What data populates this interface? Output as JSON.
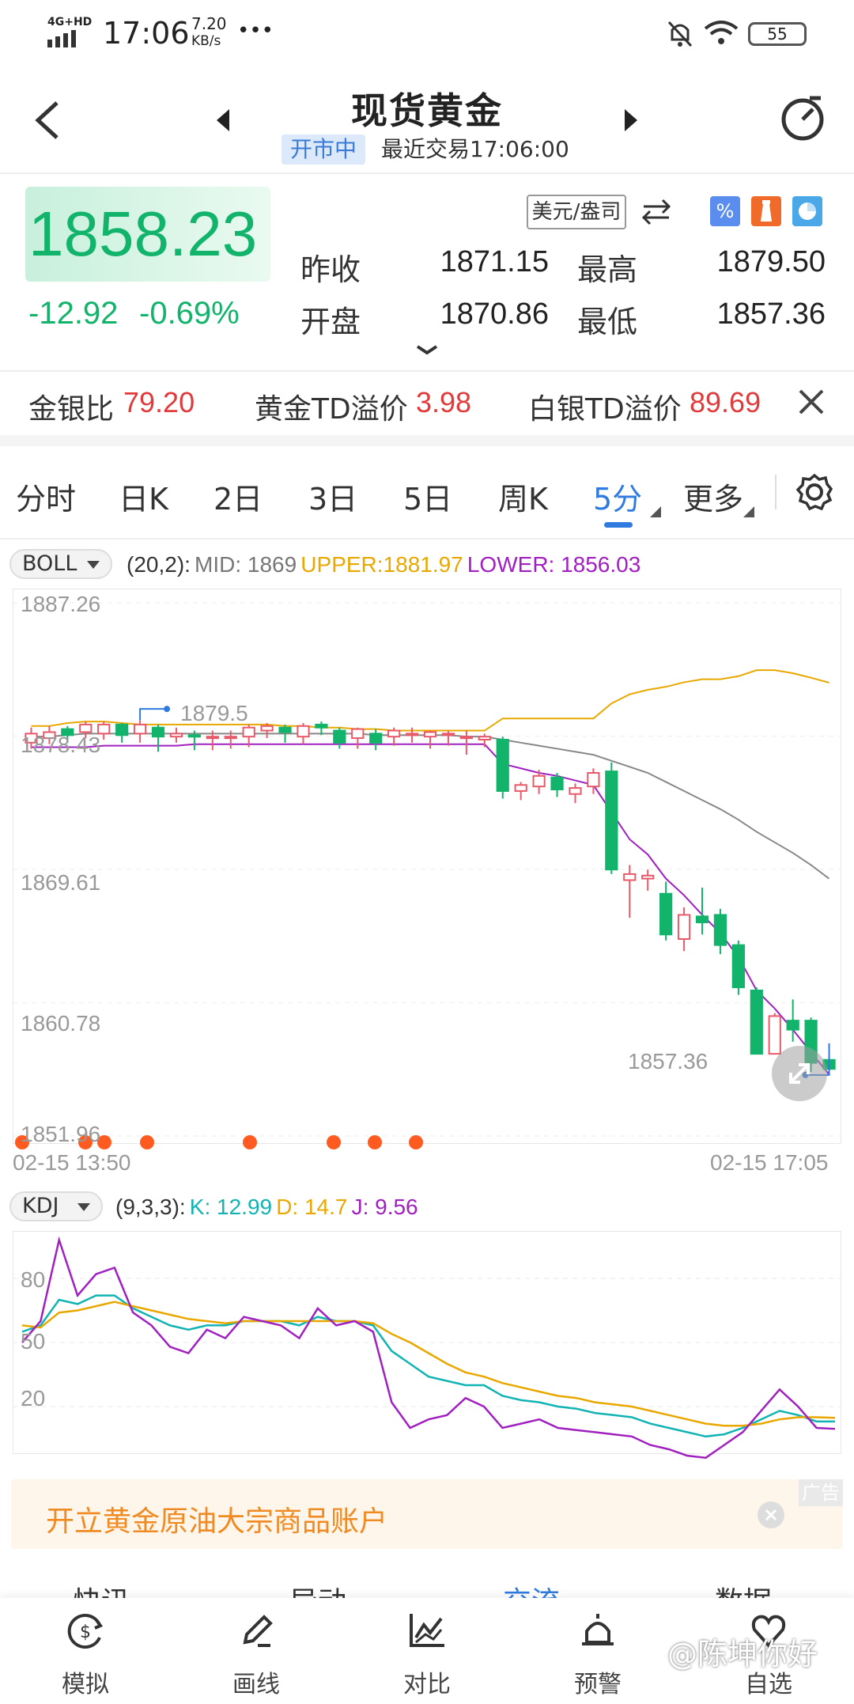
{
  "status_bar": {
    "network": "4G+HD",
    "time": "17:06",
    "speed_value": "7.20",
    "speed_unit": "KB/s",
    "more": "•••",
    "battery": "55"
  },
  "header": {
    "title": "现货黄金",
    "market_status": "开市中",
    "last_trade": "最近交易17:06:00"
  },
  "quote": {
    "price": "1858.23",
    "change": "-12.92",
    "change_pct": "-0.69%",
    "unit_button": "美元/盎司",
    "prev_close_label": "昨收",
    "prev_close": "1871.15",
    "high_label": "最高",
    "high": "1879.50",
    "open_label": "开盘",
    "open": "1870.86",
    "low_label": "最低",
    "low": "1857.36"
  },
  "ratios": {
    "gold_silver_label": "金银比",
    "gold_silver": "79.20",
    "gold_td_label": "黄金TD溢价",
    "gold_td": "3.98",
    "silver_td_label": "白银TD溢价",
    "silver_td": "89.69"
  },
  "tabs": [
    "分时",
    "日K",
    "2日",
    "3日",
    "5日",
    "周K",
    "5分",
    "更多"
  ],
  "active_tab": "5分",
  "boll": {
    "indicator": "BOLL",
    "params": "(20,2):",
    "mid": "MID: 1869",
    "upper": "UPPER:1881.97",
    "lower": "LOWER: 1856.03",
    "colors": {
      "mid": "#888888",
      "upper": "#e8a800",
      "lower": "#a020c0"
    }
  },
  "kdj": {
    "indicator": "KDJ",
    "params": "(9,3,3):",
    "k": "K: 12.99",
    "d": "D: 14.7",
    "j": "J: 9.56",
    "colors": {
      "k": "#12b3b3",
      "d": "#e8a800",
      "j": "#a020c0"
    }
  },
  "chart_data": [
    {
      "type": "candlestick",
      "y_ticks": [
        "1887.26",
        "1878.43",
        "1869.61",
        "1860.78",
        "1851.96"
      ],
      "ylim": [
        1851.96,
        1887.26
      ],
      "x_start": "02-15 13:50",
      "x_end": "02-15 17:05",
      "high_marker": "1879.5",
      "low_marker": "1857.36",
      "candles": [
        [
          1878.0,
          1878.6,
          1877.6,
          1879.0
        ],
        [
          1878.3,
          1878.7,
          1877.9,
          1879.1
        ],
        [
          1878.9,
          1878.5,
          1878.0,
          1879.1
        ],
        [
          1878.7,
          1879.2,
          1878.3,
          1879.4
        ],
        [
          1878.6,
          1879.2,
          1878.2,
          1879.4
        ],
        [
          1879.2,
          1878.5,
          1878.0,
          1879.3
        ],
        [
          1878.6,
          1879.2,
          1878.0,
          1879.5
        ],
        [
          1879.0,
          1878.4,
          1877.4,
          1879.2
        ],
        [
          1878.4,
          1878.6,
          1878.0,
          1879.0
        ],
        [
          1878.5,
          1878.4,
          1877.5,
          1878.8
        ],
        [
          1878.3,
          1878.4,
          1877.5,
          1878.8
        ],
        [
          1878.3,
          1878.4,
          1877.6,
          1878.8
        ],
        [
          1878.4,
          1879.0,
          1877.7,
          1879.2
        ],
        [
          1878.8,
          1879.1,
          1878.3,
          1879.3
        ],
        [
          1879.0,
          1878.7,
          1878.0,
          1879.2
        ],
        [
          1878.4,
          1879.1,
          1877.9,
          1879.3
        ],
        [
          1879.2,
          1879.0,
          1878.5,
          1879.4
        ],
        [
          1878.8,
          1878.0,
          1877.6,
          1879.0
        ],
        [
          1878.3,
          1878.9,
          1877.6,
          1879.0
        ],
        [
          1878.6,
          1878.0,
          1877.5,
          1878.9
        ],
        [
          1878.4,
          1878.8,
          1877.8,
          1879.0
        ],
        [
          1878.5,
          1878.6,
          1878.0,
          1879.0
        ],
        [
          1878.4,
          1878.7,
          1877.6,
          1878.8
        ],
        [
          1878.5,
          1878.6,
          1877.8,
          1878.8
        ],
        [
          1878.4,
          1878.4,
          1877.2,
          1878.8
        ],
        [
          1878.2,
          1878.4,
          1877.7,
          1878.6
        ],
        [
          1878.2,
          1874.8,
          1874.3,
          1878.4
        ],
        [
          1874.8,
          1875.2,
          1874.2,
          1875.4
        ],
        [
          1875.1,
          1875.8,
          1874.6,
          1876.2
        ],
        [
          1875.7,
          1874.9,
          1874.4,
          1876.0
        ],
        [
          1874.6,
          1875.0,
          1874.0,
          1875.3
        ],
        [
          1875.1,
          1876.0,
          1874.6,
          1876.3
        ],
        [
          1876.1,
          1869.6,
          1869.3,
          1876.7
        ],
        [
          1868.9,
          1869.3,
          1866.4,
          1869.9
        ],
        [
          1869.0,
          1869.2,
          1868.2,
          1869.6
        ],
        [
          1868.0,
          1865.3,
          1864.9,
          1868.8
        ],
        [
          1865.0,
          1866.6,
          1864.2,
          1867.1
        ],
        [
          1866.5,
          1866.1,
          1865.3,
          1868.4
        ],
        [
          1866.6,
          1864.6,
          1864.0,
          1867.0
        ],
        [
          1864.6,
          1861.8,
          1861.3,
          1864.9
        ],
        [
          1861.6,
          1857.4,
          1857.36,
          1861.8
        ],
        [
          1857.4,
          1859.9,
          1857.4,
          1860.1
        ],
        [
          1859.6,
          1859.0,
          1858.2,
          1861.0
        ],
        [
          1859.6,
          1856.8,
          1856.2,
          1859.8
        ],
        [
          1857.0,
          1856.4,
          1856.0,
          1857.2
        ]
      ],
      "upper_band": [
        1879.1,
        1879.1,
        1879.3,
        1879.4,
        1879.4,
        1879.3,
        1879.2,
        1879.2,
        1879.2,
        1879.2,
        1879.2,
        1879.2,
        1879.2,
        1879.2,
        1879.1,
        1879.1,
        1879.0,
        1879.0,
        1878.9,
        1878.9,
        1878.8,
        1878.8,
        1878.8,
        1878.8,
        1878.8,
        1878.8,
        1879.6,
        1879.6,
        1879.6,
        1879.6,
        1879.6,
        1879.6,
        1880.6,
        1881.2,
        1881.5,
        1881.7,
        1882.0,
        1882.2,
        1882.2,
        1882.4,
        1882.8,
        1882.8,
        1882.6,
        1882.3,
        1881.97
      ],
      "mid_band": [
        1878.4,
        1878.4,
        1878.5,
        1878.6,
        1878.6,
        1878.6,
        1878.6,
        1878.6,
        1878.6,
        1878.6,
        1878.6,
        1878.6,
        1878.6,
        1878.6,
        1878.6,
        1878.6,
        1878.6,
        1878.6,
        1878.6,
        1878.5,
        1878.5,
        1878.5,
        1878.5,
        1878.5,
        1878.4,
        1878.4,
        1878.2,
        1878.0,
        1877.8,
        1877.6,
        1877.4,
        1877.2,
        1876.8,
        1876.4,
        1876.0,
        1875.4,
        1874.8,
        1874.2,
        1873.6,
        1872.9,
        1872.1,
        1871.4,
        1870.7,
        1869.9,
        1869.0
      ],
      "lower_band": [
        1877.7,
        1877.7,
        1877.7,
        1877.7,
        1877.8,
        1877.8,
        1877.8,
        1877.8,
        1877.8,
        1877.9,
        1877.9,
        1877.9,
        1877.9,
        1877.9,
        1877.9,
        1877.9,
        1877.9,
        1877.9,
        1877.9,
        1877.9,
        1877.9,
        1877.9,
        1877.9,
        1877.9,
        1877.9,
        1877.9,
        1876.6,
        1876.3,
        1876.0,
        1875.8,
        1875.5,
        1875.2,
        1873.4,
        1871.6,
        1870.6,
        1869.0,
        1867.9,
        1866.6,
        1865.4,
        1863.8,
        1861.6,
        1860.4,
        1859.0,
        1857.5,
        1856.03
      ],
      "dots": 8
    },
    {
      "type": "line",
      "y_ticks": [
        "80",
        "50",
        "20"
      ],
      "ylim": [
        0,
        100
      ],
      "series": [
        {
          "name": "K",
          "values": [
            55,
            58,
            70,
            68,
            72,
            72,
            66,
            62,
            58,
            56,
            58,
            58,
            60,
            60,
            60,
            58,
            62,
            60,
            60,
            58,
            46,
            40,
            34,
            32,
            30,
            30,
            25,
            23,
            22,
            20,
            19,
            17,
            16,
            15,
            12,
            10,
            8,
            6,
            7,
            10,
            14,
            18,
            16,
            13,
            12.99
          ]
        },
        {
          "name": "D",
          "values": [
            58,
            57,
            64,
            65,
            67,
            69,
            67,
            65,
            63,
            61,
            60,
            59,
            60,
            60,
            60,
            60,
            60,
            60,
            60,
            59,
            54,
            50,
            45,
            40,
            36,
            34,
            31,
            29,
            27,
            25,
            24,
            22,
            21,
            20,
            18,
            16,
            14,
            12,
            11,
            11,
            12,
            14,
            15,
            15,
            14.7
          ]
        },
        {
          "name": "J",
          "values": [
            50,
            60,
            98,
            72,
            82,
            85,
            64,
            58,
            48,
            45,
            56,
            52,
            62,
            60,
            58,
            52,
            66,
            58,
            60,
            55,
            22,
            10,
            14,
            16,
            24,
            20,
            10,
            12,
            14,
            10,
            9,
            8,
            7,
            6,
            2,
            0,
            -3,
            -4,
            2,
            8,
            18,
            28,
            20,
            10,
            9.56
          ]
        }
      ]
    }
  ],
  "ad": {
    "text": "开立黄金原油大宗商品账户",
    "tag": "广告"
  },
  "sub_tabs": [
    "快讯",
    "异动",
    "交流",
    "数据"
  ],
  "bottom_nav": [
    {
      "label": "模拟",
      "icon": "simulate-icon"
    },
    {
      "label": "画线",
      "icon": "draw-line-icon"
    },
    {
      "label": "对比",
      "icon": "compare-icon"
    },
    {
      "label": "预警",
      "icon": "alert-icon"
    },
    {
      "label": "自选",
      "icon": "favorite-icon"
    }
  ],
  "watermark": "@陈坤你好"
}
